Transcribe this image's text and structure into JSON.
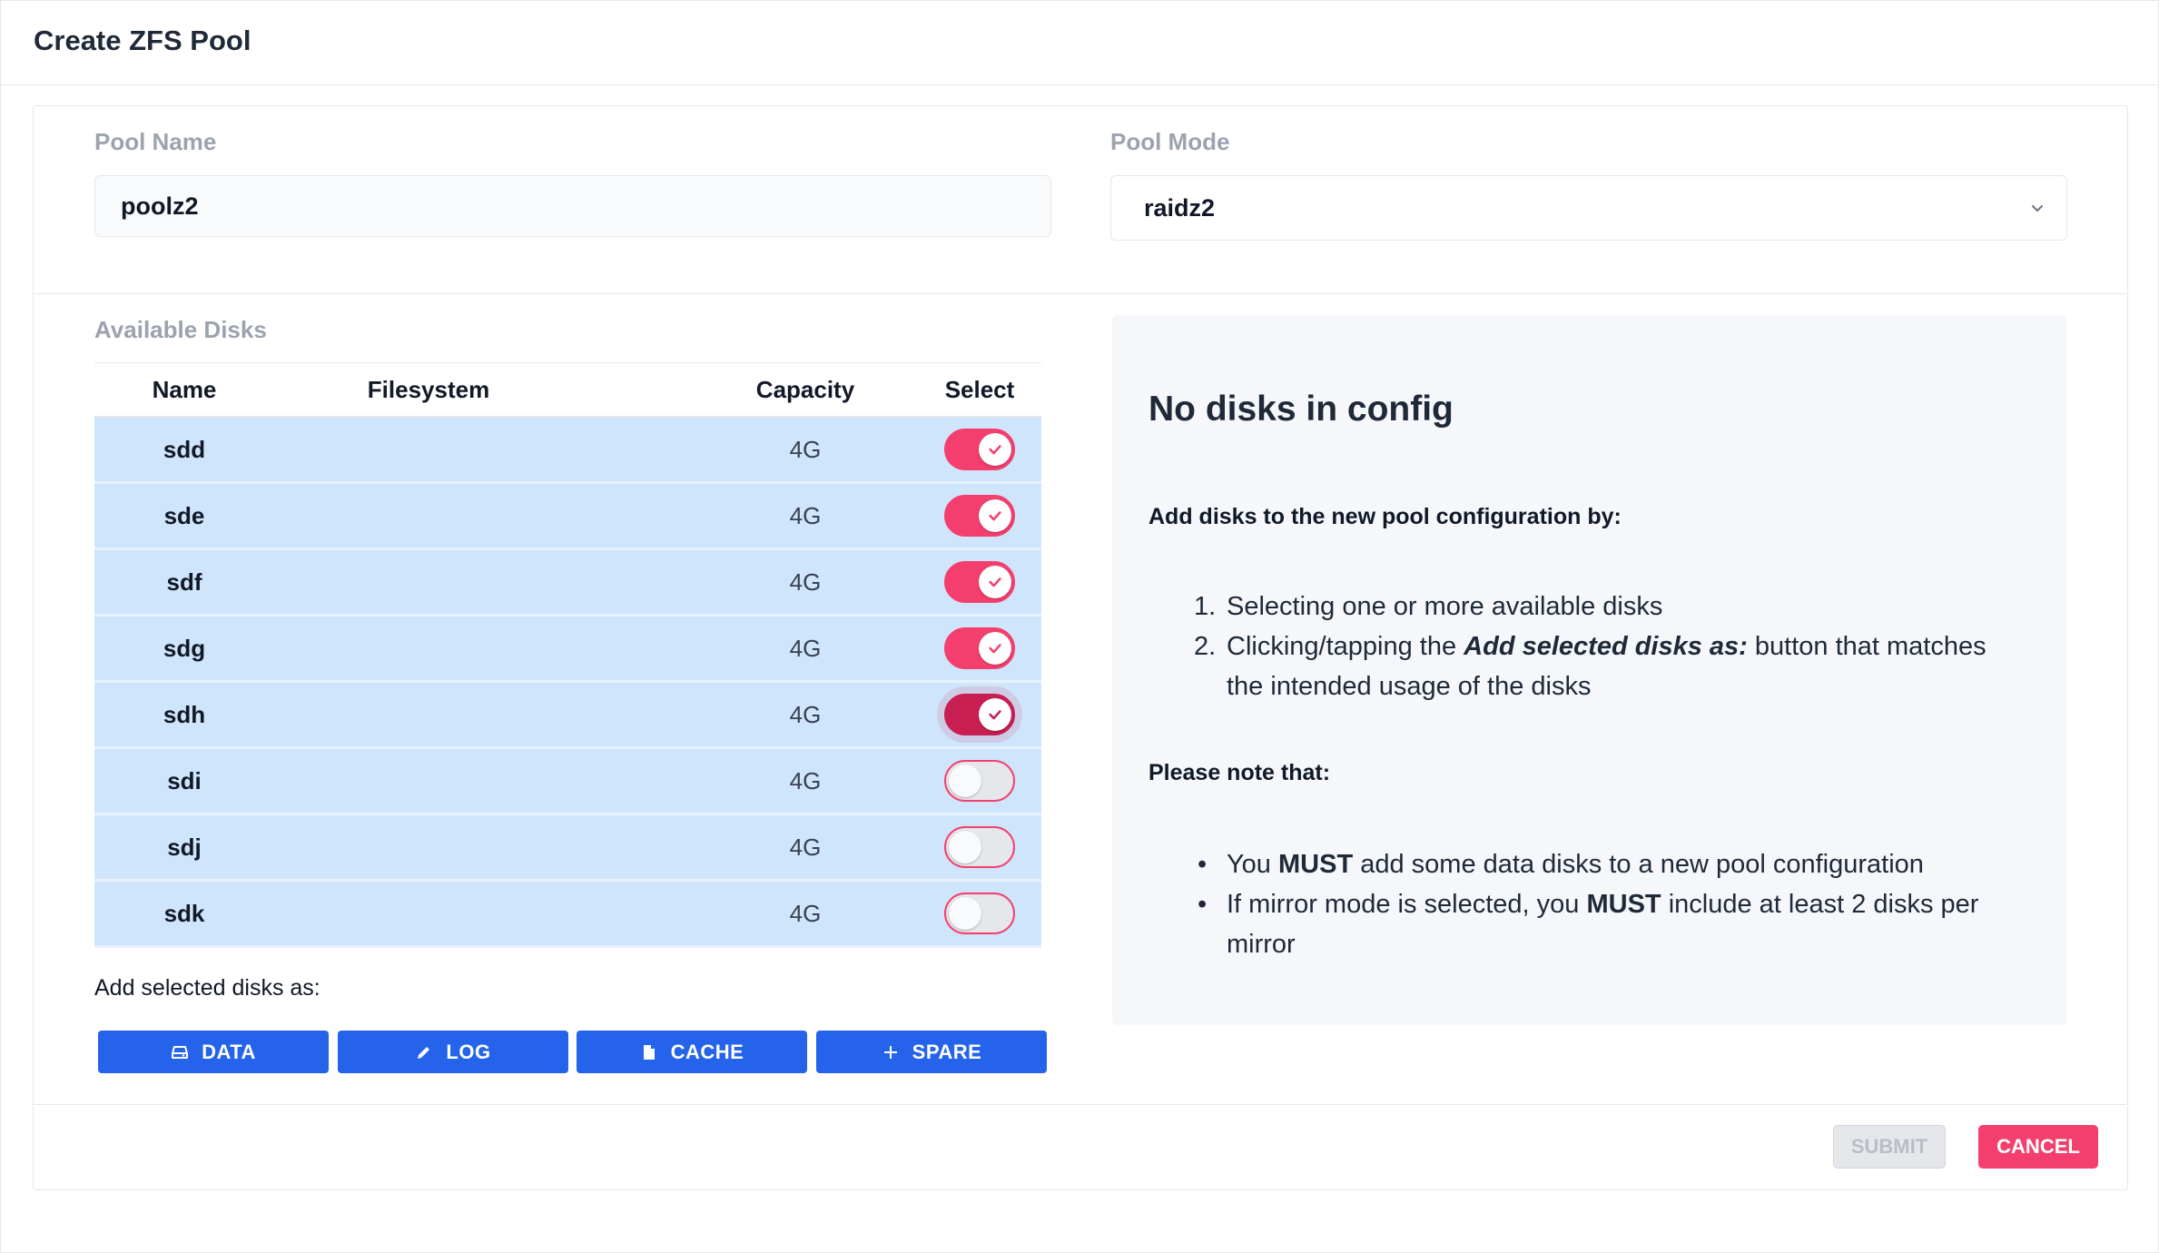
{
  "dialog": {
    "title": "Create ZFS Pool"
  },
  "pool_name": {
    "label": "Pool Name",
    "value": "poolz2"
  },
  "pool_mode": {
    "label": "Pool Mode",
    "value": "raidz2"
  },
  "disks": {
    "label": "Available Disks",
    "columns": [
      "Name",
      "Filesystem",
      "Capacity",
      "Select"
    ],
    "rows": [
      {
        "name": "sdd",
        "filesystem": "",
        "capacity": "4G",
        "selected": true
      },
      {
        "name": "sde",
        "filesystem": "",
        "capacity": "4G",
        "selected": true
      },
      {
        "name": "sdf",
        "filesystem": "",
        "capacity": "4G",
        "selected": true
      },
      {
        "name": "sdg",
        "filesystem": "",
        "capacity": "4G",
        "selected": true
      },
      {
        "name": "sdh",
        "filesystem": "",
        "capacity": "4G",
        "selected": true,
        "focused": true
      },
      {
        "name": "sdi",
        "filesystem": "",
        "capacity": "4G",
        "selected": false
      },
      {
        "name": "sdj",
        "filesystem": "",
        "capacity": "4G",
        "selected": false
      },
      {
        "name": "sdk",
        "filesystem": "",
        "capacity": "4G",
        "selected": false
      }
    ]
  },
  "add_as": {
    "label": "Add selected disks as:",
    "buttons": [
      {
        "label": "DATA",
        "icon": "drive-icon"
      },
      {
        "label": "LOG",
        "icon": "pencil-icon"
      },
      {
        "label": "CACHE",
        "icon": "file-icon"
      },
      {
        "label": "SPARE",
        "icon": "plus-icon"
      }
    ]
  },
  "info": {
    "heading": "No disks in config",
    "lead": "Add disks to the new pool configuration by:",
    "steps": {
      "step1": "Selecting one or more available disks",
      "step2_pre": "Clicking/tapping the ",
      "step2_em": "Add selected disks as:",
      "step2_post": " button that matches the intended usage of the disks"
    },
    "note_heading": "Please note that:",
    "notes": {
      "n1_pre": "You ",
      "n1_strong": "MUST",
      "n1_post": " add some data disks to a new pool configuration",
      "n2_pre": "If mirror mode is selected, you ",
      "n2_strong": "MUST",
      "n2_post": " include at least 2 disks per mirror"
    }
  },
  "footer": {
    "submit": "SUBMIT",
    "cancel": "CANCEL"
  },
  "colors": {
    "accent": "#f43f6e",
    "primary": "#2563eb",
    "row_bg": "#cfe5fb"
  }
}
